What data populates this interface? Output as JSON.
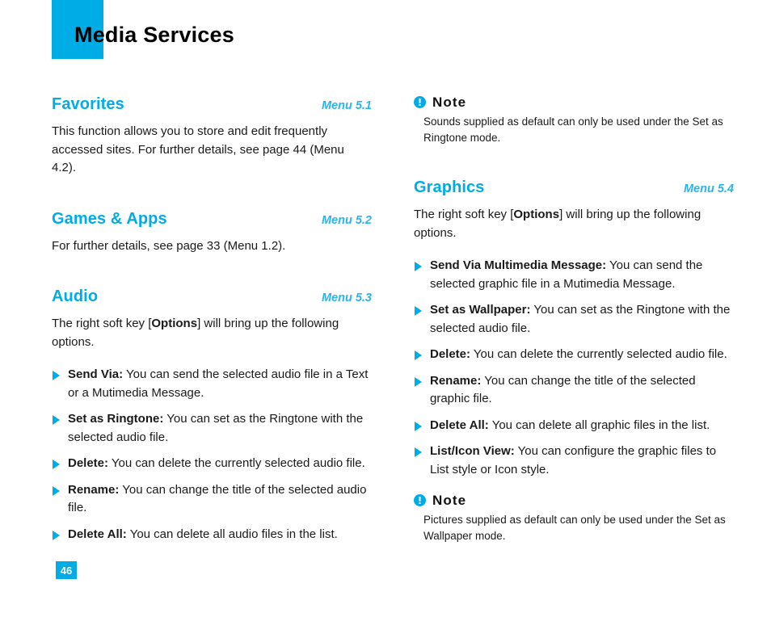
{
  "header": {
    "title": "Media Services"
  },
  "left_column": {
    "sections": [
      {
        "title": "Favorites",
        "menu": "Menu 5.1",
        "paragraph": "This function allows you to store and edit frequently accessed sites. For further details, see page 44 (Menu 4.2)."
      },
      {
        "title": "Games & Apps",
        "menu": "Menu 5.2",
        "paragraph": "For further details, see page 33 (Menu 1.2)."
      },
      {
        "title": "Audio",
        "menu": "Menu 5.3",
        "intro_pre": "The right soft key [",
        "intro_bold": "Options",
        "intro_post": "] will bring up the following options.",
        "bullets": [
          {
            "lead": "Send Via:",
            "text": " You can send the selected audio file in a Text or a Mutimedia Message."
          },
          {
            "lead": "Set as Ringtone:",
            "text": " You can set as the Ringtone with the selected audio file."
          },
          {
            "lead": "Delete:",
            "text": " You can delete the currently selected audio file."
          },
          {
            "lead": "Rename:",
            "text": " You can change the title of the selected audio file."
          },
          {
            "lead": "Delete All:",
            "text": " You can delete all audio files in the list."
          }
        ]
      }
    ]
  },
  "right_column": {
    "note_top": {
      "icon": "info-exclamation-icon",
      "title": "Note",
      "body": "Sounds supplied as default can only be used under the Set as Ringtone mode."
    },
    "graphics": {
      "title": "Graphics",
      "menu": "Menu 5.4",
      "intro_pre": "The right soft key [",
      "intro_bold": "Options",
      "intro_post": "] will bring up the following options.",
      "bullets": [
        {
          "lead": "Send Via Multimedia Message:",
          "text": " You can send the selected graphic file in a Mutimedia Message."
        },
        {
          "lead": "Set as Wallpaper:",
          "text": " You can set as the Ringtone with the selected audio file."
        },
        {
          "lead": "Delete:",
          "text": " You can delete the currently selected audio file."
        },
        {
          "lead": "Rename:",
          "text": " You can change the title of the selected graphic file."
        },
        {
          "lead": "Delete All:",
          "text": " You can delete all graphic files in the list."
        },
        {
          "lead": "List/Icon View:",
          "text": " You can configure the graphic files to List style or Icon  style."
        }
      ]
    },
    "note_bottom": {
      "icon": "info-exclamation-icon",
      "title": "Note",
      "body": "Pictures supplied as default can only be used under the Set as Wallpaper mode."
    }
  },
  "footer": {
    "page_number": "46"
  },
  "colors": {
    "accent": "#00ace6",
    "menu_label": "#2ab4ef",
    "body_text": "#1a1a1a",
    "page_background": "#ffffff"
  }
}
